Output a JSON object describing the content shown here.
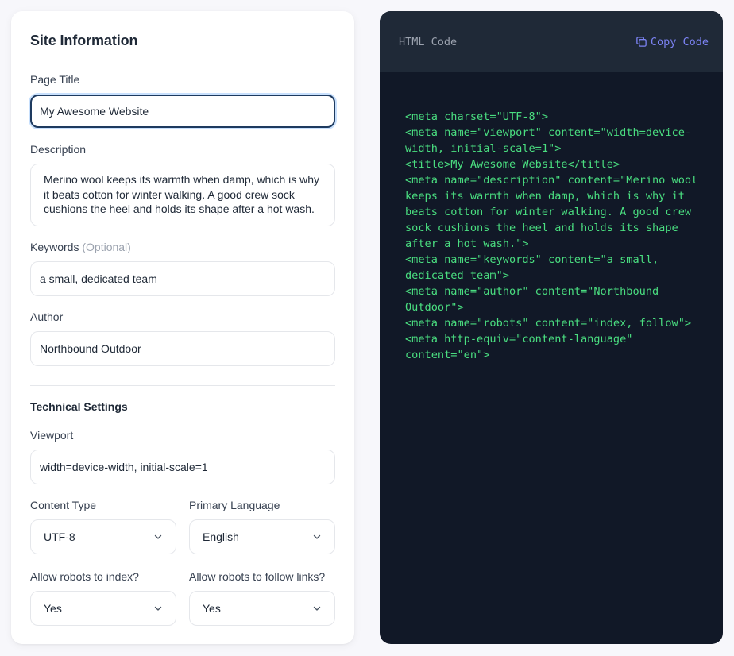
{
  "site_info": {
    "title": "Site Information",
    "page_title": {
      "label": "Page Title",
      "value": "My Awesome Website"
    },
    "description": {
      "label": "Description",
      "value": "Merino wool keeps its warmth when damp, which is why it beats cotton for winter walking. A good crew sock cushions the heel and holds its shape after a hot wash."
    },
    "keywords": {
      "label": "Keywords",
      "optional": "(Optional)",
      "value": "a small, dedicated team"
    },
    "author": {
      "label": "Author",
      "value": "Northbound Outdoor"
    }
  },
  "technical": {
    "title": "Technical Settings",
    "viewport": {
      "label": "Viewport",
      "value": "width=device-width, initial-scale=1"
    },
    "content_type": {
      "label": "Content Type",
      "value": "UTF-8"
    },
    "primary_language": {
      "label": "Primary Language",
      "value": "English"
    },
    "robots_index": {
      "label": "Allow robots to index?",
      "value": "Yes"
    },
    "robots_follow": {
      "label": "Allow robots to follow links?",
      "value": "Yes"
    }
  },
  "code_panel": {
    "title": "HTML Code",
    "copy_label": "Copy Code",
    "lines": [
      "<meta charset=\"UTF-8\">",
      "<meta name=\"viewport\" content=\"width=device-width, initial-scale=1\">",
      "<title>My Awesome Website</title>",
      "<meta name=\"description\" content=\"Merino wool keeps its warmth when damp, which is why it beats cotton for winter walking. A good crew sock cushions the heel and holds its shape after a hot wash.\">",
      "<meta name=\"keywords\" content=\"a small, dedicated team\">",
      "<meta name=\"author\" content=\"Northbound Outdoor\">",
      "<meta name=\"robots\" content=\"index, follow\">",
      "<meta http-equiv=\"content-language\" content=\"en\">"
    ]
  },
  "icons": {
    "copy": "copy-icon",
    "dropdown": "chevron-down-icon"
  },
  "colors": {
    "accent": "#7c83f4",
    "code_text": "#4ade80",
    "code_bg": "#111827",
    "focus_border": "#1e3a5f"
  }
}
